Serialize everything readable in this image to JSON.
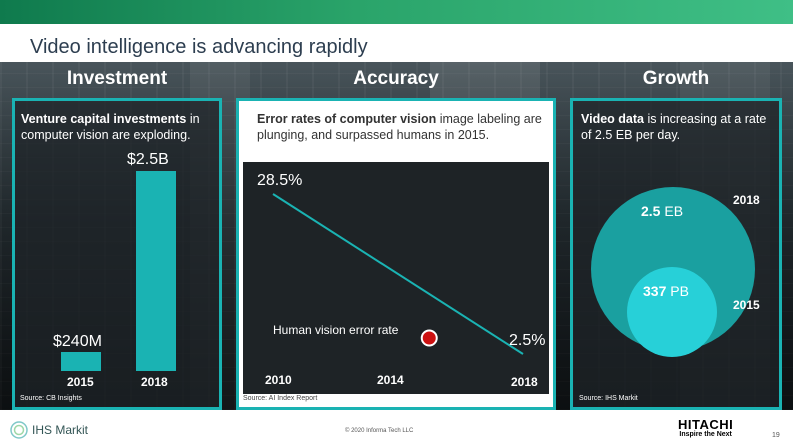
{
  "slide": {
    "title": "Video intelligence is advancing rapidly"
  },
  "columns": {
    "investment": {
      "heading": "Investment",
      "desc_bold": "Venture capital investments",
      "desc_rest": " in computer vision are exploding.",
      "bars": [
        {
          "label": "$240M",
          "year": "2015"
        },
        {
          "label": "$2.5B",
          "year": "2018"
        }
      ],
      "source": "Source: CB Insights"
    },
    "accuracy": {
      "heading": "Accuracy",
      "desc_bold": "Error rates of computer vision",
      "desc_rest": " image labeling are plunging, and surpassed humans in 2015.",
      "start_label": "28.5%",
      "end_label": "2.5%",
      "marker_label": "Human vision error rate",
      "x_labels": [
        "2010",
        "2014",
        "2018"
      ],
      "source": "Source: AI Index Report"
    },
    "growth": {
      "heading": "Growth",
      "desc_bold": "Video data",
      "desc_rest": " is increasing at a rate of 2.5 EB per day.",
      "big": {
        "value": "2.5",
        "unit": " EB",
        "year": "2018"
      },
      "small": {
        "value": "337",
        "unit": " PB",
        "year": "2015"
      },
      "source": "Source: IHS Markit"
    }
  },
  "chart_data": [
    {
      "type": "bar",
      "categories": [
        "2015",
        "2018"
      ],
      "values": [
        240,
        2500
      ],
      "value_labels": [
        "$240M",
        "$2.5B"
      ],
      "ylim": [
        0,
        2500
      ]
    },
    {
      "type": "line",
      "x": [
        2010,
        2018
      ],
      "y": [
        28.5,
        2.5
      ],
      "xlim": [
        2010,
        2018
      ],
      "x_ticks": [
        "2010",
        "2014",
        "2018"
      ],
      "annotations": [
        {
          "text": "Human vision error rate",
          "x": 2015,
          "y": 5.1
        }
      ]
    }
  ],
  "colors": {
    "accent": "#1ab3b3",
    "marker": "#cc1111",
    "top_band": "#2aa46a"
  },
  "footer": {
    "logo": "IHS Markit",
    "copyright": "© 2020 Informa Tech LLC",
    "brand": "HITACHI",
    "tagline": "Inspire the Next",
    "page": "19"
  }
}
